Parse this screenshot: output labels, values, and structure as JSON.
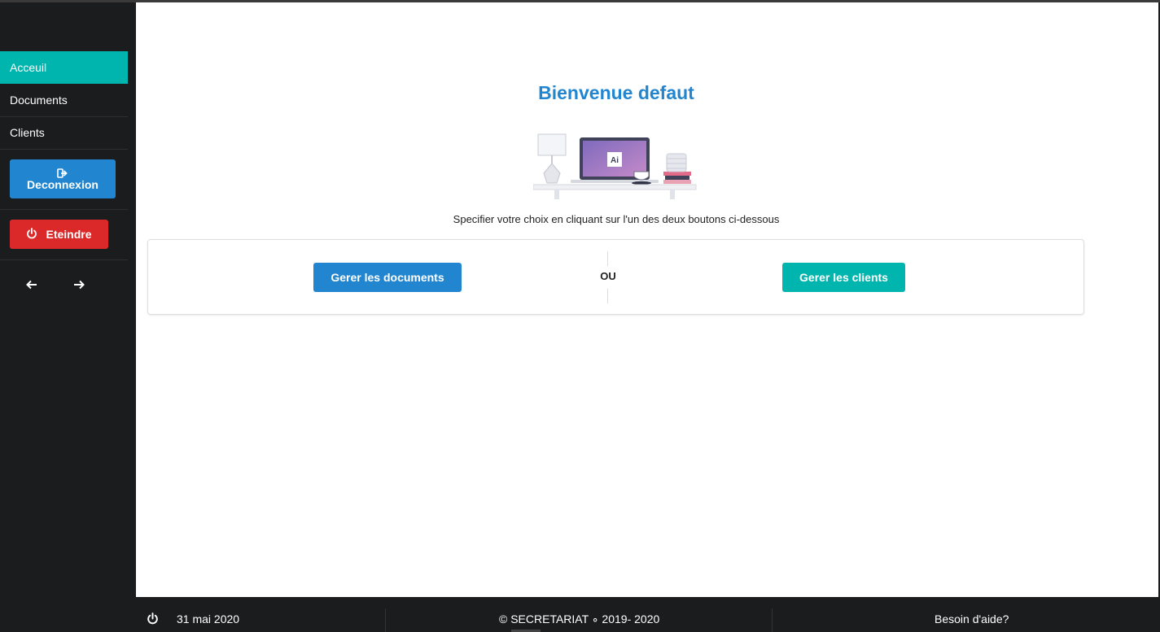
{
  "sidebar": {
    "items": [
      {
        "label": "Acceuil",
        "active": true
      },
      {
        "label": "Documents",
        "active": false
      },
      {
        "label": "Clients",
        "active": false
      }
    ],
    "logout_label": "Deconnexion",
    "power_label": "Eteindre"
  },
  "main": {
    "title": "Bienvenue defaut",
    "illustration_badge": "Ai",
    "subtitle": "Specifier votre choix en cliquant sur l'un des deux boutons ci-dessous",
    "docs_button": "Gerer les documents",
    "or_label": "OU",
    "clients_button": "Gerer les clients"
  },
  "footer": {
    "date": "31 mai 2020",
    "copyright": "© SECRETARIAT ∘ 2019- 2020",
    "help": "Besoin d'aide?"
  },
  "colors": {
    "accent_teal": "#00b5ad",
    "accent_blue": "#2185d0",
    "danger_red": "#db2828",
    "sidebar_bg": "#1b1c1e"
  },
  "icons": [
    "sign-out-icon",
    "power-icon",
    "arrow-left-icon",
    "arrow-right-icon"
  ]
}
